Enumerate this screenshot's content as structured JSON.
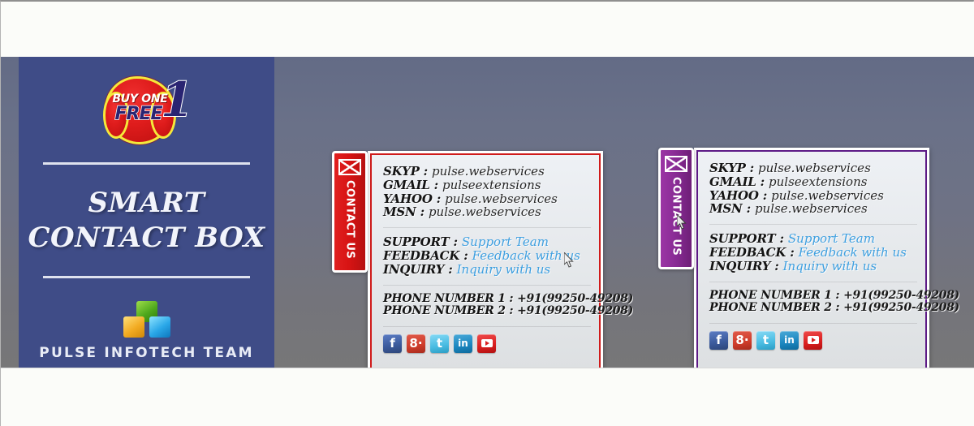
{
  "sidebar": {
    "promo_badge": {
      "line1": "BUY ONE",
      "line2": "FREE",
      "numeral": "1"
    },
    "title_line1": "SMART",
    "title_line2": "CONTACT BOX",
    "brand_name": "PULSE INFOTECH TEAM",
    "brand_icon": "cubes-icon",
    "background_color": "#3f4c87"
  },
  "widgets": [
    {
      "id": "contact-box-red",
      "accent_color": "#cf1b1b",
      "tab_label": "CONTACT US",
      "tab_icon": "envelope-icon",
      "contacts": [
        {
          "label": "SKYP",
          "value": "pulse.webservices"
        },
        {
          "label": "GMAIL",
          "value": "pulseextensions"
        },
        {
          "label": "YAHOO",
          "value": "pulse.webservices"
        },
        {
          "label": "MSN",
          "value": "pulse.webservices"
        }
      ],
      "links": [
        {
          "label": "SUPPORT",
          "value": "Support Team"
        },
        {
          "label": "FEEDBACK",
          "value": "Feedback with us"
        },
        {
          "label": "INQUIRY",
          "value": "Inquiry with us"
        }
      ],
      "phones": [
        {
          "label": "PHONE NUMBER 1",
          "value": "+91(99250-49208)"
        },
        {
          "label": "PHONE NUMBER 2",
          "value": "+91(99250-49208)"
        }
      ],
      "social": [
        {
          "name": "facebook-icon",
          "glyph": "f"
        },
        {
          "name": "google-plus-icon",
          "glyph": "8·"
        },
        {
          "name": "twitter-icon",
          "glyph": "t"
        },
        {
          "name": "linkedin-icon",
          "glyph": "in"
        },
        {
          "name": "youtube-icon",
          "glyph": ""
        }
      ]
    },
    {
      "id": "contact-box-purple",
      "accent_color": "#5d1a86",
      "tab_label": "CONTACT US",
      "tab_icon": "envelope-icon",
      "contacts": [
        {
          "label": "SKYP",
          "value": "pulse.webservices"
        },
        {
          "label": "GMAIL",
          "value": "pulseextensions"
        },
        {
          "label": "YAHOO",
          "value": "pulse.webservices"
        },
        {
          "label": "MSN",
          "value": "pulse.webservices"
        }
      ],
      "links": [
        {
          "label": "SUPPORT",
          "value": "Support Team"
        },
        {
          "label": "FEEDBACK",
          "value": "Feedback with us"
        },
        {
          "label": "INQUIRY",
          "value": "Inquiry with us"
        }
      ],
      "phones": [
        {
          "label": "PHONE NUMBER 1",
          "value": "+91(99250-49208)"
        },
        {
          "label": "PHONE NUMBER 2",
          "value": "+91(99250-49208)"
        }
      ],
      "social": [
        {
          "name": "facebook-icon",
          "glyph": "f"
        },
        {
          "name": "google-plus-icon",
          "glyph": "8·"
        },
        {
          "name": "twitter-icon",
          "glyph": "t"
        },
        {
          "name": "linkedin-icon",
          "glyph": "in"
        },
        {
          "name": "youtube-icon",
          "glyph": ""
        }
      ]
    }
  ],
  "colors": {
    "page_background": "#fbfcf9",
    "viewport_gradient_top": "#636b86",
    "viewport_gradient_bottom": "#777778",
    "sidebar": "#3f4c87",
    "red_accent": "#cf1b1b",
    "purple_accent": "#5d1a86",
    "link_blue": "#3d9fe0"
  }
}
